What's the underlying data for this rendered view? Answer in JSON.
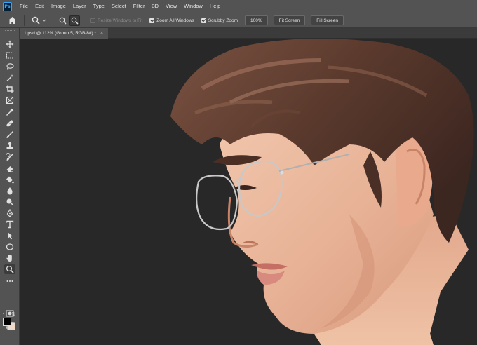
{
  "app": {
    "logo_text": "Ps"
  },
  "menu": [
    "File",
    "Edit",
    "Image",
    "Layer",
    "Type",
    "Select",
    "Filter",
    "3D",
    "View",
    "Window",
    "Help"
  ],
  "options_bar": {
    "resize_windows": {
      "label": "Resize Windows to Fit",
      "checked": false,
      "disabled": true
    },
    "zoom_all_windows": {
      "label": "Zoom All Windows",
      "checked": true
    },
    "scrubby_zoom": {
      "label": "Scrubby Zoom",
      "checked": true
    },
    "zoom_100_label": "100%",
    "fit_screen_label": "Fit Screen",
    "fill_screen_label": "Fill Screen"
  },
  "document_tab": {
    "title": "1.psd @ 112% (Group 5, RGB/8#) *",
    "close": "×"
  },
  "tools": [
    "move-tool",
    "marquee-tool",
    "lasso-tool",
    "quick-selection-tool",
    "crop-tool",
    "frame-tool",
    "eyedropper-tool",
    "healing-brush-tool",
    "brush-tool",
    "clone-stamp-tool",
    "history-brush-tool",
    "eraser-tool",
    "paint-bucket-tool",
    "blur-tool",
    "dodge-tool",
    "pen-tool",
    "type-tool",
    "path-selection-tool",
    "ellipse-tool",
    "hand-tool",
    "zoom-tool",
    "edit-toolbar"
  ],
  "colors": {
    "foreground": "#000000",
    "background": "#f2d8c0",
    "ui_panel": "#535353",
    "canvas_bg": "#282828",
    "hair": "#5a3a2c",
    "skin": "#e7b59b"
  },
  "artwork": {
    "subject": "painted-portrait"
  }
}
